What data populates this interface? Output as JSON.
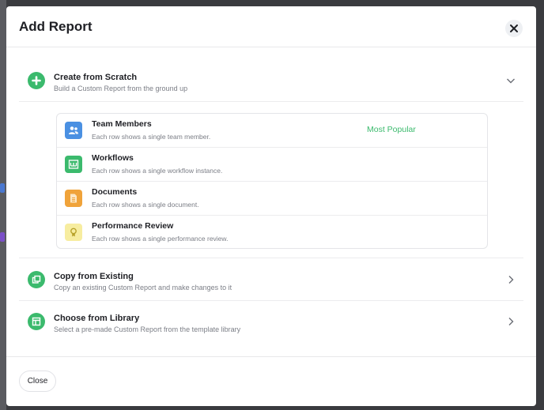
{
  "modal": {
    "title": "Add Report",
    "close_label": "Close"
  },
  "options": {
    "scratch": {
      "title": "Create from Scratch",
      "subtitle": "Build a Custom Report from the ground up",
      "chevron": "chevron-down-icon"
    },
    "copy": {
      "title": "Copy from Existing",
      "subtitle": "Copy an existing Custom Report and make changes to it",
      "chevron": "chevron-right-icon"
    },
    "library": {
      "title": "Choose from Library",
      "subtitle": "Select a pre-made Custom Report from the template library",
      "chevron": "chevron-right-icon"
    }
  },
  "report_types": [
    {
      "title": "Team Members",
      "subtitle": "Each row shows a single team member.",
      "badge": "Most Popular",
      "icon": "people-icon",
      "color": "#4a90e2"
    },
    {
      "title": "Workflows",
      "subtitle": "Each row shows a single workflow instance.",
      "icon": "workflow-icon",
      "color": "#3bba6d"
    },
    {
      "title": "Documents",
      "subtitle": "Each row shows a single document.",
      "icon": "document-icon",
      "color": "#f0a33a"
    },
    {
      "title": "Performance Review",
      "subtitle": "Each row shows a single performance review.",
      "icon": "award-icon",
      "color": "#f7eda0"
    }
  ],
  "colors": {
    "accent": "#3bba6d"
  }
}
